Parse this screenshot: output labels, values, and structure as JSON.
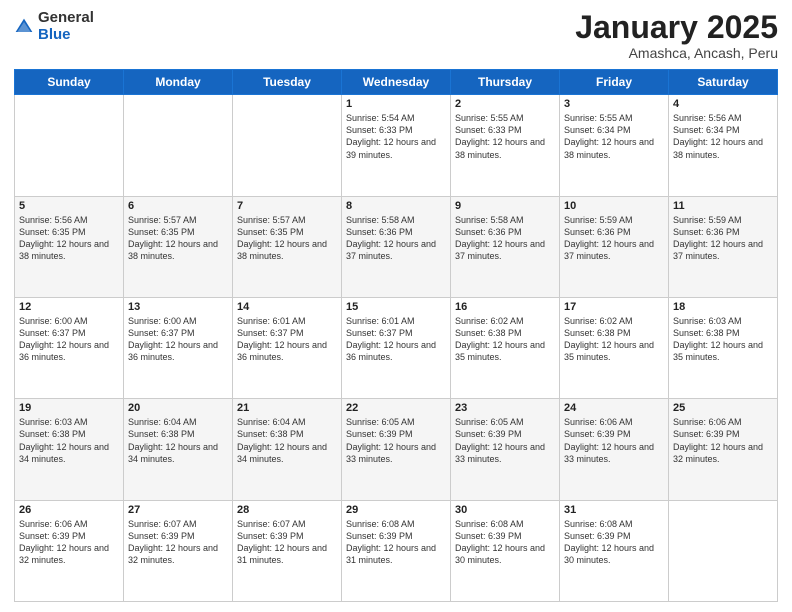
{
  "logo": {
    "general": "General",
    "blue": "Blue"
  },
  "header": {
    "month": "January 2025",
    "location": "Amashca, Ancash, Peru"
  },
  "weekdays": [
    "Sunday",
    "Monday",
    "Tuesday",
    "Wednesday",
    "Thursday",
    "Friday",
    "Saturday"
  ],
  "weeks": [
    {
      "shaded": false,
      "days": [
        {
          "num": "",
          "sunrise": "",
          "sunset": "",
          "daylight": ""
        },
        {
          "num": "",
          "sunrise": "",
          "sunset": "",
          "daylight": ""
        },
        {
          "num": "",
          "sunrise": "",
          "sunset": "",
          "daylight": ""
        },
        {
          "num": "1",
          "sunrise": "Sunrise: 5:54 AM",
          "sunset": "Sunset: 6:33 PM",
          "daylight": "Daylight: 12 hours and 39 minutes."
        },
        {
          "num": "2",
          "sunrise": "Sunrise: 5:55 AM",
          "sunset": "Sunset: 6:33 PM",
          "daylight": "Daylight: 12 hours and 38 minutes."
        },
        {
          "num": "3",
          "sunrise": "Sunrise: 5:55 AM",
          "sunset": "Sunset: 6:34 PM",
          "daylight": "Daylight: 12 hours and 38 minutes."
        },
        {
          "num": "4",
          "sunrise": "Sunrise: 5:56 AM",
          "sunset": "Sunset: 6:34 PM",
          "daylight": "Daylight: 12 hours and 38 minutes."
        }
      ]
    },
    {
      "shaded": true,
      "days": [
        {
          "num": "5",
          "sunrise": "Sunrise: 5:56 AM",
          "sunset": "Sunset: 6:35 PM",
          "daylight": "Daylight: 12 hours and 38 minutes."
        },
        {
          "num": "6",
          "sunrise": "Sunrise: 5:57 AM",
          "sunset": "Sunset: 6:35 PM",
          "daylight": "Daylight: 12 hours and 38 minutes."
        },
        {
          "num": "7",
          "sunrise": "Sunrise: 5:57 AM",
          "sunset": "Sunset: 6:35 PM",
          "daylight": "Daylight: 12 hours and 38 minutes."
        },
        {
          "num": "8",
          "sunrise": "Sunrise: 5:58 AM",
          "sunset": "Sunset: 6:36 PM",
          "daylight": "Daylight: 12 hours and 37 minutes."
        },
        {
          "num": "9",
          "sunrise": "Sunrise: 5:58 AM",
          "sunset": "Sunset: 6:36 PM",
          "daylight": "Daylight: 12 hours and 37 minutes."
        },
        {
          "num": "10",
          "sunrise": "Sunrise: 5:59 AM",
          "sunset": "Sunset: 6:36 PM",
          "daylight": "Daylight: 12 hours and 37 minutes."
        },
        {
          "num": "11",
          "sunrise": "Sunrise: 5:59 AM",
          "sunset": "Sunset: 6:36 PM",
          "daylight": "Daylight: 12 hours and 37 minutes."
        }
      ]
    },
    {
      "shaded": false,
      "days": [
        {
          "num": "12",
          "sunrise": "Sunrise: 6:00 AM",
          "sunset": "Sunset: 6:37 PM",
          "daylight": "Daylight: 12 hours and 36 minutes."
        },
        {
          "num": "13",
          "sunrise": "Sunrise: 6:00 AM",
          "sunset": "Sunset: 6:37 PM",
          "daylight": "Daylight: 12 hours and 36 minutes."
        },
        {
          "num": "14",
          "sunrise": "Sunrise: 6:01 AM",
          "sunset": "Sunset: 6:37 PM",
          "daylight": "Daylight: 12 hours and 36 minutes."
        },
        {
          "num": "15",
          "sunrise": "Sunrise: 6:01 AM",
          "sunset": "Sunset: 6:37 PM",
          "daylight": "Daylight: 12 hours and 36 minutes."
        },
        {
          "num": "16",
          "sunrise": "Sunrise: 6:02 AM",
          "sunset": "Sunset: 6:38 PM",
          "daylight": "Daylight: 12 hours and 35 minutes."
        },
        {
          "num": "17",
          "sunrise": "Sunrise: 6:02 AM",
          "sunset": "Sunset: 6:38 PM",
          "daylight": "Daylight: 12 hours and 35 minutes."
        },
        {
          "num": "18",
          "sunrise": "Sunrise: 6:03 AM",
          "sunset": "Sunset: 6:38 PM",
          "daylight": "Daylight: 12 hours and 35 minutes."
        }
      ]
    },
    {
      "shaded": true,
      "days": [
        {
          "num": "19",
          "sunrise": "Sunrise: 6:03 AM",
          "sunset": "Sunset: 6:38 PM",
          "daylight": "Daylight: 12 hours and 34 minutes."
        },
        {
          "num": "20",
          "sunrise": "Sunrise: 6:04 AM",
          "sunset": "Sunset: 6:38 PM",
          "daylight": "Daylight: 12 hours and 34 minutes."
        },
        {
          "num": "21",
          "sunrise": "Sunrise: 6:04 AM",
          "sunset": "Sunset: 6:38 PM",
          "daylight": "Daylight: 12 hours and 34 minutes."
        },
        {
          "num": "22",
          "sunrise": "Sunrise: 6:05 AM",
          "sunset": "Sunset: 6:39 PM",
          "daylight": "Daylight: 12 hours and 33 minutes."
        },
        {
          "num": "23",
          "sunrise": "Sunrise: 6:05 AM",
          "sunset": "Sunset: 6:39 PM",
          "daylight": "Daylight: 12 hours and 33 minutes."
        },
        {
          "num": "24",
          "sunrise": "Sunrise: 6:06 AM",
          "sunset": "Sunset: 6:39 PM",
          "daylight": "Daylight: 12 hours and 33 minutes."
        },
        {
          "num": "25",
          "sunrise": "Sunrise: 6:06 AM",
          "sunset": "Sunset: 6:39 PM",
          "daylight": "Daylight: 12 hours and 32 minutes."
        }
      ]
    },
    {
      "shaded": false,
      "days": [
        {
          "num": "26",
          "sunrise": "Sunrise: 6:06 AM",
          "sunset": "Sunset: 6:39 PM",
          "daylight": "Daylight: 12 hours and 32 minutes."
        },
        {
          "num": "27",
          "sunrise": "Sunrise: 6:07 AM",
          "sunset": "Sunset: 6:39 PM",
          "daylight": "Daylight: 12 hours and 32 minutes."
        },
        {
          "num": "28",
          "sunrise": "Sunrise: 6:07 AM",
          "sunset": "Sunset: 6:39 PM",
          "daylight": "Daylight: 12 hours and 31 minutes."
        },
        {
          "num": "29",
          "sunrise": "Sunrise: 6:08 AM",
          "sunset": "Sunset: 6:39 PM",
          "daylight": "Daylight: 12 hours and 31 minutes."
        },
        {
          "num": "30",
          "sunrise": "Sunrise: 6:08 AM",
          "sunset": "Sunset: 6:39 PM",
          "daylight": "Daylight: 12 hours and 30 minutes."
        },
        {
          "num": "31",
          "sunrise": "Sunrise: 6:08 AM",
          "sunset": "Sunset: 6:39 PM",
          "daylight": "Daylight: 12 hours and 30 minutes."
        },
        {
          "num": "",
          "sunrise": "",
          "sunset": "",
          "daylight": ""
        }
      ]
    }
  ]
}
